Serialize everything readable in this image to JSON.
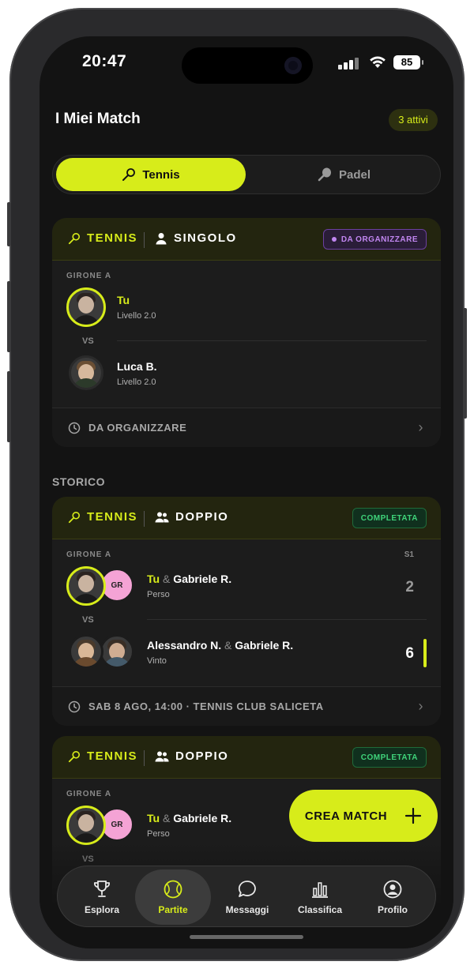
{
  "status_bar": {
    "time": "20:47",
    "battery": "85"
  },
  "header": {
    "title": "I Miei Match",
    "active_badge": "3 attivi"
  },
  "sport_toggle": {
    "options": [
      {
        "label": "Tennis",
        "active": true
      },
      {
        "label": "Padel",
        "active": false
      }
    ]
  },
  "upcoming_match": {
    "sport": "TENNIS",
    "mode": "SINGOLO",
    "status": "DA ORGANIZZARE",
    "group": "GIRONE A",
    "player1": {
      "name": "Tu",
      "level": "Livello 2.0"
    },
    "vs": "VS",
    "player2": {
      "name": "Luca B.",
      "level": "Livello 2.0"
    },
    "footer": "DA ORGANIZZARE"
  },
  "history_label": "STORICO",
  "history": [
    {
      "sport": "TENNIS",
      "mode": "DOPPIO",
      "status": "COMPLETATA",
      "group": "GIRONE A",
      "set_label": "S1",
      "team1": {
        "name_a": "Tu",
        "amp": "&",
        "name_b": "Gabriele R.",
        "result": "Perso",
        "partner_initials": "GR",
        "score": "2"
      },
      "vs": "VS",
      "team2": {
        "name_a": "Alessandro N.",
        "amp": "&",
        "name_b": "Gabriele R.",
        "result": "Vinto",
        "score": "6"
      },
      "footer": "SAB 8 AGO, 14:00 · TENNIS CLUB SALICETA"
    },
    {
      "sport": "TENNIS",
      "mode": "DOPPIO",
      "status": "COMPLETATA",
      "group": "GIRONE A",
      "team1": {
        "name_a": "Tu",
        "amp": "&",
        "name_b": "Gabriele R.",
        "result": "Perso",
        "partner_initials": "GR"
      },
      "vs": "VS"
    }
  ],
  "fab": {
    "label": "CREA MATCH"
  },
  "tabbar": {
    "items": [
      {
        "label": "Esplora",
        "icon": "trophy-icon",
        "active": false
      },
      {
        "label": "Partite",
        "icon": "tennis-ball-icon",
        "active": true
      },
      {
        "label": "Messaggi",
        "icon": "chat-icon",
        "active": false
      },
      {
        "label": "Classifica",
        "icon": "bar-chart-icon",
        "active": false
      },
      {
        "label": "Profilo",
        "icon": "profile-icon",
        "active": false
      }
    ]
  },
  "colors": {
    "accent": "#d7ec1a",
    "background": "#131313",
    "card": "#1c1c1c",
    "completed": "#3fd37a",
    "to_organize": "#c186f0"
  }
}
